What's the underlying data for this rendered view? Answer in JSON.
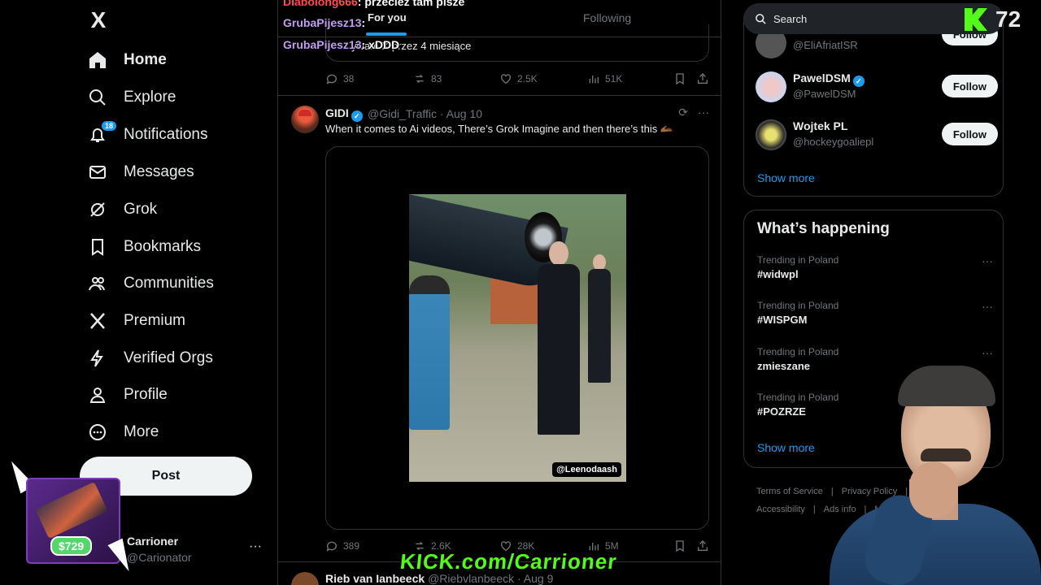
{
  "nav": {
    "logo": "X",
    "items": [
      {
        "label": "Home",
        "icon": "home-icon",
        "active": true
      },
      {
        "label": "Explore",
        "icon": "search-icon"
      },
      {
        "label": "Notifications",
        "icon": "bell-icon",
        "badge": "18"
      },
      {
        "label": "Messages",
        "icon": "envelope-icon"
      },
      {
        "label": "Grok",
        "icon": "grok-icon"
      },
      {
        "label": "Bookmarks",
        "icon": "bookmark-icon"
      },
      {
        "label": "Communities",
        "icon": "people-icon"
      },
      {
        "label": "Premium",
        "icon": "x-icon"
      },
      {
        "label": "Verified Orgs",
        "icon": "lightning-icon"
      },
      {
        "label": "Profile",
        "icon": "person-icon"
      },
      {
        "label": "More",
        "icon": "more-circle-icon"
      }
    ],
    "post_label": "Post",
    "account": {
      "name": "Carrioner",
      "handle": "@Carionator",
      "more": "···"
    }
  },
  "promo": {
    "price": "$729"
  },
  "feed": {
    "tabs": {
      "for_you": "For you",
      "following": "Following"
    },
    "chat": [
      {
        "user": "Diabolong666",
        "msg": ": przecież tam pisze"
      },
      {
        "user": "GrubaPijesz13",
        "msg": ":"
      },
      {
        "user": "GrubaPijesz13",
        "msg": ": xDDD"
      }
    ],
    "prev_tweet": {
      "quote_text": "ywam X przez 4 miesiące",
      "stats": {
        "replies": "38",
        "reposts": "83",
        "likes": "2.5K",
        "views": "51K"
      }
    },
    "tweet": {
      "name": "GIDI",
      "handle": "@Gidi_Traffic · Aug 10",
      "text": "When it comes to Ai videos, There’s Grok Imagine and then there’s this 🫴🏾",
      "video_tag": "@Leenodaash",
      "stats": {
        "replies": "389",
        "reposts": "2.6K",
        "likes": "28K",
        "views": "5M"
      }
    },
    "next_tweet": {
      "name": "Rieb van Ianbeeck",
      "handle": "@Riebvlanbeeck · Aug 9"
    }
  },
  "right": {
    "search_placeholder": "Search",
    "who_to_follow": [
      {
        "name": "",
        "handle": "@EliAfriatISR",
        "button": "Follow"
      },
      {
        "name": "PawelDSM",
        "handle": "@PawelDSM",
        "button": "Follow"
      },
      {
        "name": "Wojtek PL",
        "handle": "@hockeygoaliepl",
        "button": "Follow"
      }
    ],
    "show_more": "Show more",
    "happening_title": "What’s happening",
    "trends": [
      {
        "context": "Trending in Poland",
        "tag": "#widwpl"
      },
      {
        "context": "Trending in Poland",
        "tag": "#WISPGM"
      },
      {
        "context": "Trending in Poland",
        "tag": "zmieszane"
      },
      {
        "context": "Trending in Poland",
        "tag": "#POZRZE"
      }
    ],
    "show_more_2": "Show more",
    "footer": [
      "Terms of Service",
      "|",
      "Privacy Policy",
      "|",
      "C",
      "Accessibility",
      "|",
      "Ads info",
      "|",
      "More"
    ]
  },
  "overlay": {
    "kick_viewers": "72",
    "kick_banner": "KICK.com/Carrioner"
  },
  "colors": {
    "accent": "#1d9bf0",
    "kick_green": "#53fc18",
    "chat_user": "#c49cf2"
  }
}
